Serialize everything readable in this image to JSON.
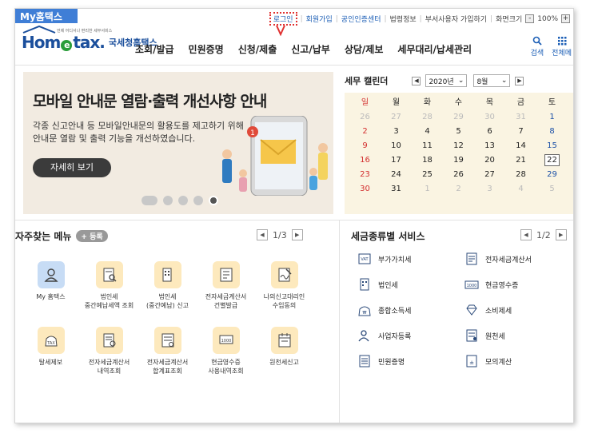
{
  "topbar": {
    "my_tab": "My홈택스",
    "links": [
      "로그인",
      "회원가입",
      "공인인증센터",
      "법령정보",
      "부서사용자 가입하기",
      "화면크기"
    ],
    "zoom": "100%",
    "zoom_minus": "-",
    "zoom_plus": "+"
  },
  "logo": {
    "text": "Hometax",
    "sub": "언제 어디서나 편리한 세무서비스",
    "kr": "국세청홈택스"
  },
  "nav": {
    "items": [
      "조회/발급",
      "민원증명",
      "신청/제출",
      "신고/납부",
      "상담/제보",
      "세무대리/납세관리"
    ],
    "search": "검색",
    "all_menu": "전체메"
  },
  "banner": {
    "title": "모바일 안내문 열람·출력 개선사항 안내",
    "desc_line1": "각종 신고안내 등 모바일안내문의 활용도를 제고하기 위해",
    "desc_line2": "안내문 열람 및 출력 기능을 개선하였습니다.",
    "button": "자세히 보기",
    "notification_count": "1"
  },
  "calendar": {
    "title": "세무 캘린더",
    "year": "2020년",
    "month": "8월",
    "weekdays": [
      "일",
      "월",
      "화",
      "수",
      "목",
      "금",
      "토"
    ],
    "weeks": [
      [
        [
          "26",
          "muted"
        ],
        [
          "27",
          "muted"
        ],
        [
          "28",
          "muted"
        ],
        [
          "29",
          "muted"
        ],
        [
          "30",
          "muted"
        ],
        [
          "31",
          "muted"
        ],
        [
          "1",
          "sat"
        ]
      ],
      [
        [
          "2",
          "sun"
        ],
        [
          "3",
          ""
        ],
        [
          "4",
          ""
        ],
        [
          "5",
          ""
        ],
        [
          "6",
          ""
        ],
        [
          "7",
          ""
        ],
        [
          "8",
          "sat"
        ]
      ],
      [
        [
          "9",
          "sun"
        ],
        [
          "10",
          ""
        ],
        [
          "11",
          ""
        ],
        [
          "12",
          ""
        ],
        [
          "13",
          ""
        ],
        [
          "14",
          ""
        ],
        [
          "15",
          "sat"
        ]
      ],
      [
        [
          "16",
          "sun"
        ],
        [
          "17",
          ""
        ],
        [
          "18",
          ""
        ],
        [
          "19",
          ""
        ],
        [
          "20",
          ""
        ],
        [
          "21",
          ""
        ],
        [
          "22",
          "today"
        ]
      ],
      [
        [
          "23",
          "sun"
        ],
        [
          "24",
          ""
        ],
        [
          "25",
          ""
        ],
        [
          "26",
          ""
        ],
        [
          "27",
          ""
        ],
        [
          "28",
          ""
        ],
        [
          "29",
          "sat"
        ]
      ],
      [
        [
          "30",
          "sun"
        ],
        [
          "31",
          ""
        ],
        [
          "1",
          "muted"
        ],
        [
          "2",
          "muted"
        ],
        [
          "3",
          "muted"
        ],
        [
          "4",
          "muted"
        ],
        [
          "5",
          "muted"
        ]
      ]
    ]
  },
  "favorites": {
    "title": "자주찾는 메뉴",
    "add_badge": "+ 등록",
    "page": "1/3",
    "items": [
      {
        "label": "My 홈택스",
        "icon": "person-icon",
        "blue": true
      },
      {
        "label": "법인세\n중간예납세액 조회",
        "icon": "document-search-icon"
      },
      {
        "label": "법인세\n(중간예납) 신고",
        "icon": "building-document-icon"
      },
      {
        "label": "전자세금계산서\n건별발급",
        "icon": "invoice-icon"
      },
      {
        "label": "나의신고대리인\n수임동의",
        "icon": "signature-icon"
      },
      {
        "label": "탈세제보",
        "icon": "tax-bag-icon"
      },
      {
        "label": "전자세금계산서\n내역조회",
        "icon": "invoice-search-icon"
      },
      {
        "label": "전자세금계산서\n합계표조회",
        "icon": "invoice-summary-icon"
      },
      {
        "label": "현금영수증\n사용내역조회",
        "icon": "receipt-search-icon"
      },
      {
        "label": "원천세신고",
        "icon": "calendar-document-icon"
      }
    ]
  },
  "tax_services": {
    "title": "세금종류별 서비스",
    "page": "1/2",
    "items": [
      {
        "label": "부가가치세",
        "icon": "vat-icon"
      },
      {
        "label": "전자세금계산서",
        "icon": "e-invoice-icon"
      },
      {
        "label": "법인세",
        "icon": "corporate-tax-icon"
      },
      {
        "label": "현금영수증",
        "icon": "cash-receipt-icon"
      },
      {
        "label": "종합소득세",
        "icon": "income-tax-icon"
      },
      {
        "label": "소비제세",
        "icon": "diamond-icon"
      },
      {
        "label": "사업자등록",
        "icon": "business-person-icon"
      },
      {
        "label": "원천세",
        "icon": "withholding-icon"
      },
      {
        "label": "민원증명",
        "icon": "certificate-icon"
      },
      {
        "label": "모의계산",
        "icon": "calculator-icon"
      }
    ]
  },
  "colors": {
    "brand_blue": "#1b4f9c",
    "link_blue": "#1a5db5",
    "banner_bg": "#f2ebe1",
    "calendar_bg": "#faf4e2",
    "sunday": "#d32f2f",
    "saturday": "#1a4fa6",
    "fav_icon_bg": "#fde9bd"
  }
}
